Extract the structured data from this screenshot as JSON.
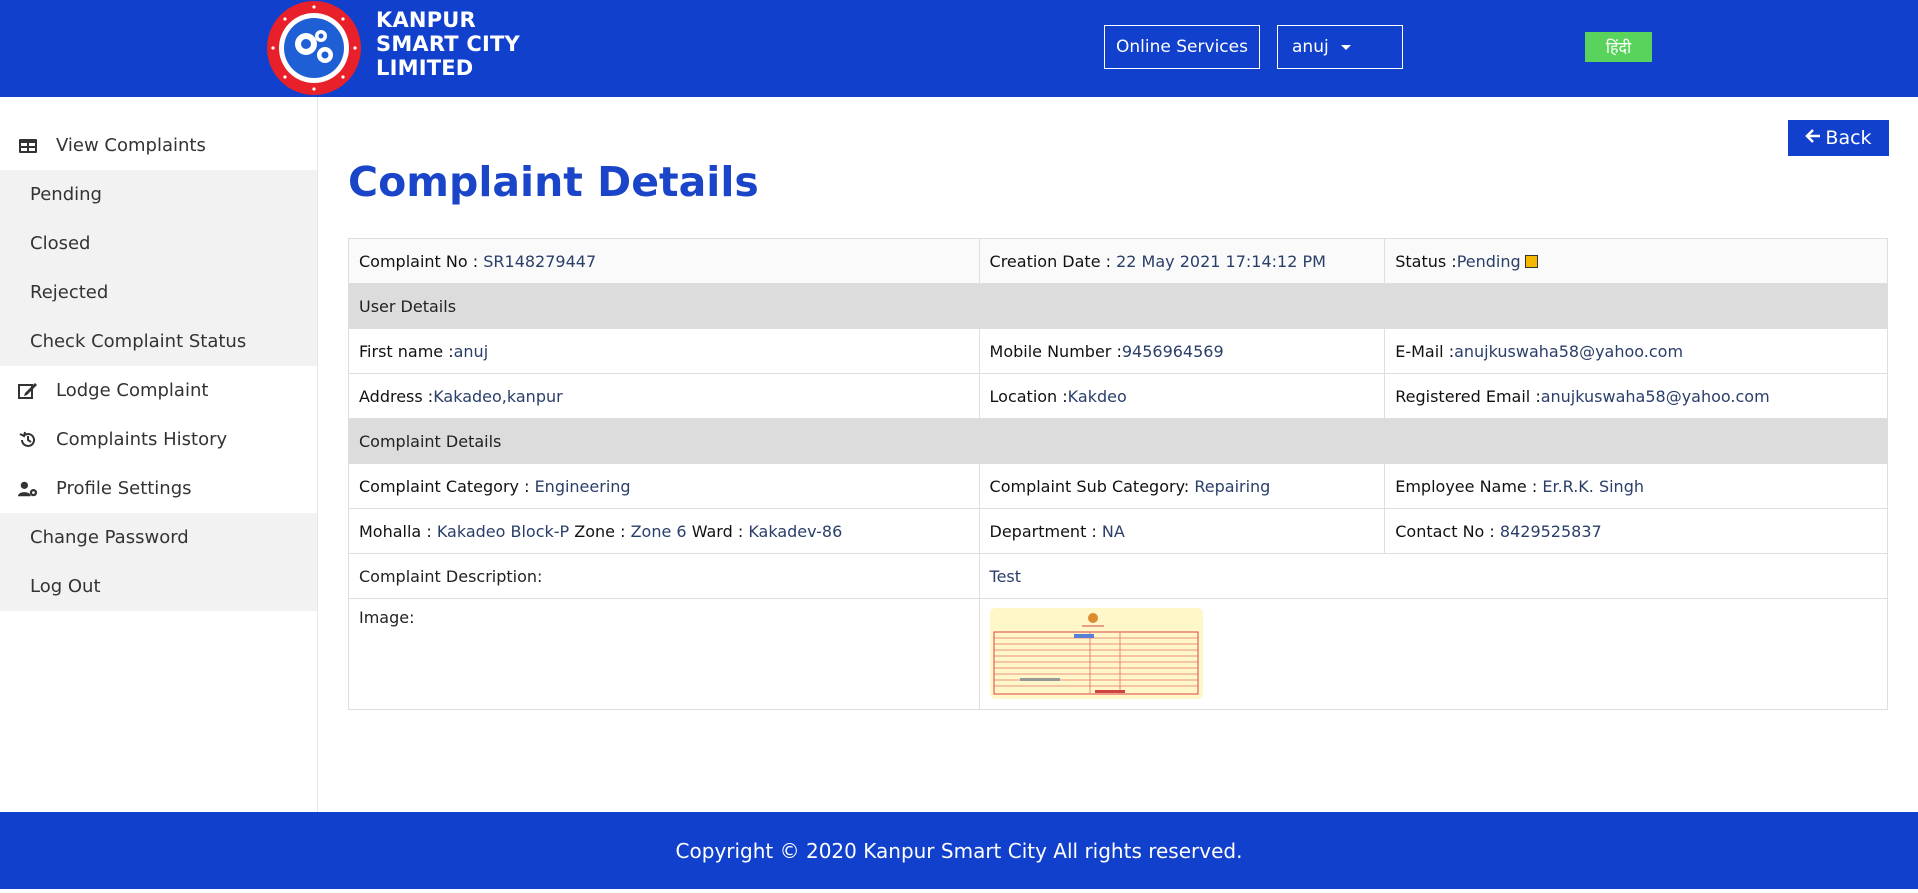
{
  "header": {
    "brand_line1": "KANPUR",
    "brand_line2": "SMART CITY",
    "brand_line3": "LIMITED",
    "emblem_text": "KANPUR SMART CITY LTD. KANPUR",
    "online_services": "Online Services",
    "user_menu": "anuj",
    "language_toggle": "हिंदी",
    "accent_color": "#1040cc"
  },
  "sidebar": {
    "items": [
      {
        "label": "View Complaints",
        "icon": "table-icon"
      },
      {
        "label": "Pending"
      },
      {
        "label": "Closed"
      },
      {
        "label": "Rejected"
      },
      {
        "label": "Check Complaint Status"
      },
      {
        "label": "Lodge Complaint",
        "icon": "edit-icon"
      },
      {
        "label": "Complaints History",
        "icon": "history-icon"
      },
      {
        "label": "Profile Settings",
        "icon": "user-cog-icon"
      },
      {
        "label": "Change Password"
      },
      {
        "label": "Log Out"
      }
    ]
  },
  "main": {
    "back_label": "Back",
    "title": "Complaint Details",
    "complaint_no_label": "Complaint No :",
    "complaint_no": "SR148279447",
    "creation_date_label": "Creation Date :",
    "creation_date": "22 May 2021 17:14:12 PM",
    "status_label": "Status :",
    "status": "Pending",
    "status_color": "#f5b800",
    "user_section": "User Details",
    "first_name_label": "First name :",
    "first_name": "anuj",
    "mobile_label": "Mobile Number :",
    "mobile": "9456964569",
    "email_label": "E-Mail :",
    "email": "anujkuswaha58@yahoo.com",
    "address_label": "Address :",
    "address": "Kakadeo,kanpur",
    "location_label": "Location :",
    "location": "Kakdeo",
    "reg_email_label": "Registered Email :",
    "reg_email": "anujkuswaha58@yahoo.com",
    "complaint_section": "Complaint Details",
    "category_label": "Complaint Category :",
    "category": "Engineering",
    "subcategory_label": "Complaint Sub Category:",
    "subcategory": "Repairing",
    "employee_label": "Employee Name :",
    "employee": "Er.R.K. Singh",
    "mohalla_label": "Mohalla :",
    "mohalla": "Kakadeo Block-P",
    "zone_label": "Zone :",
    "zone": "Zone 6",
    "ward_label": "Ward :",
    "ward": "Kakadev-86",
    "department_label": "Department :",
    "department": "NA",
    "contact_label": "Contact No :",
    "contact": "8429525837",
    "description_label": "Complaint Description:",
    "description": "Test",
    "image_label": "Image:"
  },
  "footer": {
    "copyright": "Copyright © 2020 Kanpur Smart City All rights reserved."
  }
}
